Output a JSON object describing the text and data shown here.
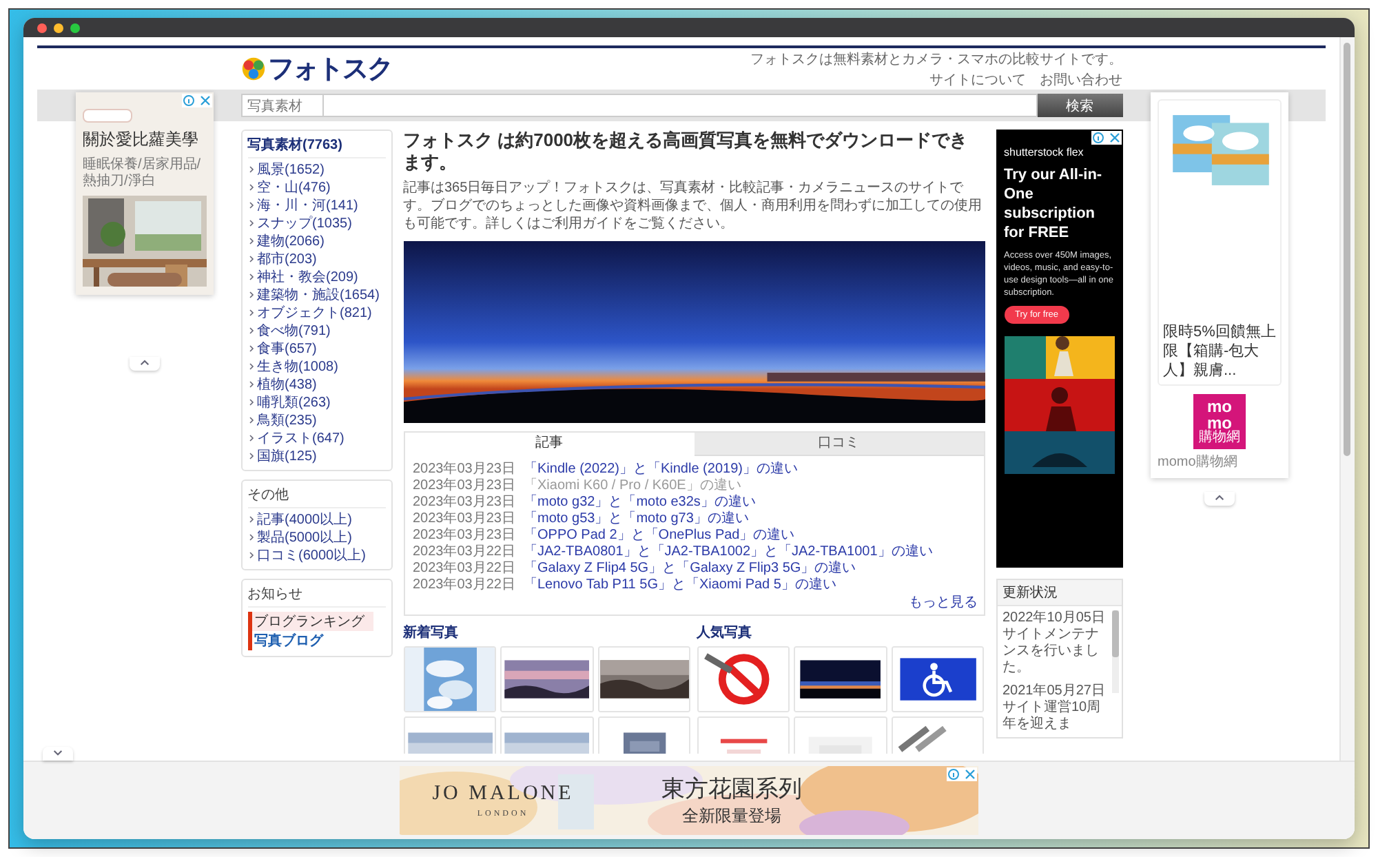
{
  "header": {
    "logo": "フォトスク",
    "tagline": "フォトスクは無料素材とカメラ・スマホの比較サイトです。",
    "links": [
      "サイトについて",
      "お問い合わせ"
    ]
  },
  "search": {
    "label": "写真素材",
    "button": "検索"
  },
  "sidebar": [
    {
      "title": "写真素材(7763)",
      "items": [
        "風景(1652)",
        "空・山(476)",
        "海・川・河(141)",
        "スナップ(1035)",
        "建物(2066)",
        "都市(203)",
        "神社・教会(209)",
        "建築物・施設(1654)",
        "オブジェクト(821)",
        "食べ物(791)",
        "食事(657)",
        "生き物(1008)",
        "植物(438)",
        "哺乳類(263)",
        "鳥類(235)",
        "イラスト(647)",
        "国旗(125)"
      ]
    },
    {
      "title": "その他",
      "items": [
        "記事(4000以上)",
        "製品(5000以上)",
        "口コミ(6000以上)"
      ]
    },
    {
      "title": "お知らせ",
      "badge": {
        "top": "ブログランキング",
        "bottom": "写真ブログ"
      }
    }
  ],
  "intro": {
    "heading": "フォトスク は約7000枚を超える高画質写真を無料でダウンロードできます。",
    "text": "記事は365日毎日アップ！フォトスクは、写真素材・比較記事・カメラニュースのサイトです。ブログでのちょっとした画像や資料画像まで、個人・商用利用を問わずに加工しての使用も可能です。詳しくはご利用ガイドをご覧ください。"
  },
  "news_tabs": [
    {
      "label": "記事",
      "selected": true
    },
    {
      "label": "口コミ",
      "selected": false
    }
  ],
  "news": [
    {
      "date": "2023年03月23日",
      "title": "「Kindle (2022)」と「Kindle (2019)」の違い",
      "visited": false
    },
    {
      "date": "2023年03月23日",
      "title": "「Xiaomi K60 / Pro / K60E」の違い",
      "visited": true
    },
    {
      "date": "2023年03月23日",
      "title": "「moto g32」と「moto e32s」の違い",
      "visited": false
    },
    {
      "date": "2023年03月23日",
      "title": "「moto g53」と「moto g73」の違い",
      "visited": false
    },
    {
      "date": "2023年03月23日",
      "title": "「OPPO Pad 2」と「OnePlus Pad」の違い",
      "visited": false
    },
    {
      "date": "2023年03月22日",
      "title": "「JA2-TBA0801」と「JA2-TBA1002」と「JA2-TBA1001」の違い",
      "visited": false
    },
    {
      "date": "2023年03月22日",
      "title": "「Galaxy Z Flip4 5G」と「Galaxy Z Flip3 5G」の違い",
      "visited": false
    },
    {
      "date": "2023年03月22日",
      "title": "「Lenovo Tab P11 5G」と「Xiaomi Pad 5」の違い",
      "visited": false
    }
  ],
  "more_link": "もっと見る",
  "gallery": [
    {
      "title": "新着写真"
    },
    {
      "title": "人気写真"
    }
  ],
  "update_status": {
    "title": "更新状況",
    "entries": [
      {
        "date": "2022年10月05日",
        "text": "サイトメンテナンスを行いました。"
      },
      {
        "date": "2021年05月27日",
        "text": "サイト運営10周年を迎えま"
      }
    ]
  },
  "ads": {
    "left": {
      "title": "關於愛比蘿美學",
      "subtitle": "睡眠保養/居家用品/熱抽刀/淨白"
    },
    "column": {
      "brand": "shutterstock flex",
      "headline": "Try our All-in-One subscription for FREE",
      "body": "Access over 450M images, videos, music, and easy-to-use design tools—all in one subscription.",
      "button": "Try for free"
    },
    "right": {
      "title": "限時5%回饋無上限【箱購-包大人】親膚...",
      "logo": [
        "mo",
        "mo",
        "購物網"
      ],
      "caption": "momo購物網"
    },
    "bottom": {
      "brand": "JO MALONE",
      "brand_sub": "LONDON",
      "headline": "東方花園系列",
      "subline": "全新限量登場"
    }
  }
}
